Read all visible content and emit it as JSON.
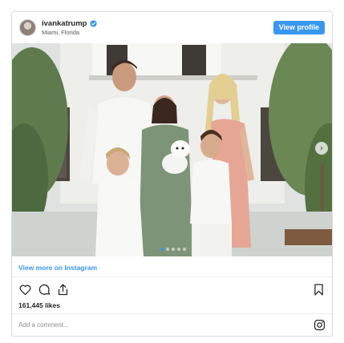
{
  "header": {
    "username": "ivankatrump",
    "location": "Miami, Florida",
    "view_profile_label": "View profile",
    "verified_color": "#3897f0",
    "avatar_icon": "profile-avatar"
  },
  "photo": {
    "description_icon": "family-photo",
    "next_icon": "chevron-right-icon",
    "carousel_dots": 5,
    "active_dot": 1
  },
  "links": {
    "view_more": "View more on Instagram"
  },
  "actions": {
    "like_icon": "heart-icon",
    "comment_icon": "comment-icon",
    "share_icon": "share-icon",
    "save_icon": "bookmark-icon"
  },
  "likes_text": "161,445 likes",
  "comment_placeholder": "Add a comment...",
  "footer_icon": "instagram-icon",
  "colors": {
    "accent": "#3897f0",
    "border": "#dbdbdb",
    "text": "#262626",
    "muted": "#8e8e8e"
  }
}
